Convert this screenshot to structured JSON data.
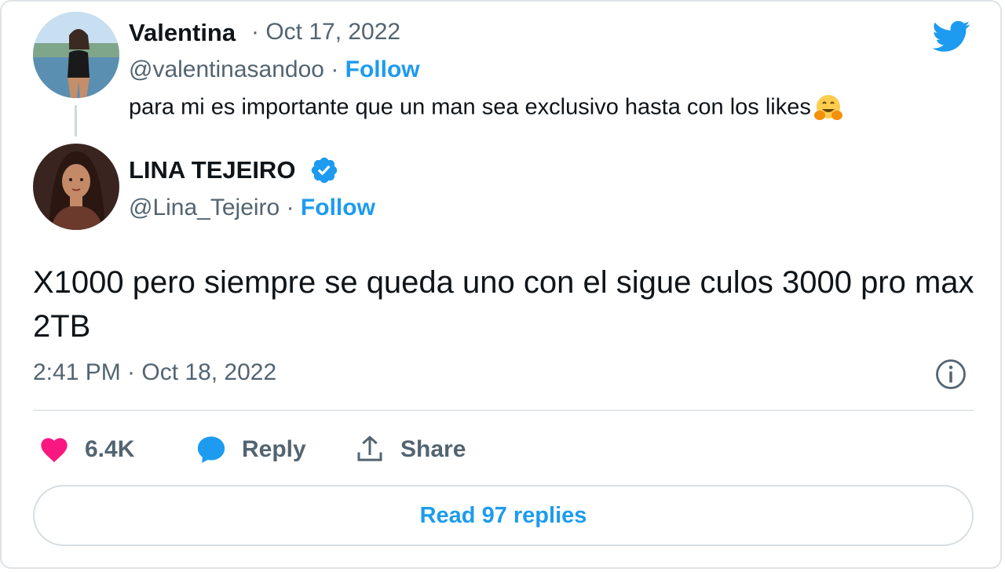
{
  "original_tweet": {
    "display_name": "Valentina",
    "date": "· Oct 17, 2022",
    "handle": "@valentinasandoo",
    "separator": "·",
    "follow_label": "Follow",
    "text": "para mi es importante que un man sea exclusivo hasta con los likes",
    "emoji": "hugging-face"
  },
  "reply_tweet": {
    "display_name": "LINA TEJEIRO",
    "verified": true,
    "handle": "@Lina_Tejeiro",
    "separator": "·",
    "follow_label": "Follow",
    "text": "X1000 pero siempre se queda uno con el sigue culos 3000 pro max 2TB",
    "timestamp": "2:41 PM · Oct 18, 2022"
  },
  "actions": {
    "like_count": "6.4K",
    "reply_label": "Reply",
    "share_label": "Share"
  },
  "read_replies_label": "Read 97 replies",
  "icons": {
    "brand": "twitter-bird-icon",
    "info": "info-icon",
    "like": "heart-icon",
    "reply": "comment-bubble-icon",
    "share": "share-icon",
    "verified": "verified-badge-icon"
  },
  "colors": {
    "accent": "#1d9bf0",
    "like": "#f91880",
    "text": "#0f1419",
    "muted": "#536471",
    "border": "#dfe3e6"
  }
}
